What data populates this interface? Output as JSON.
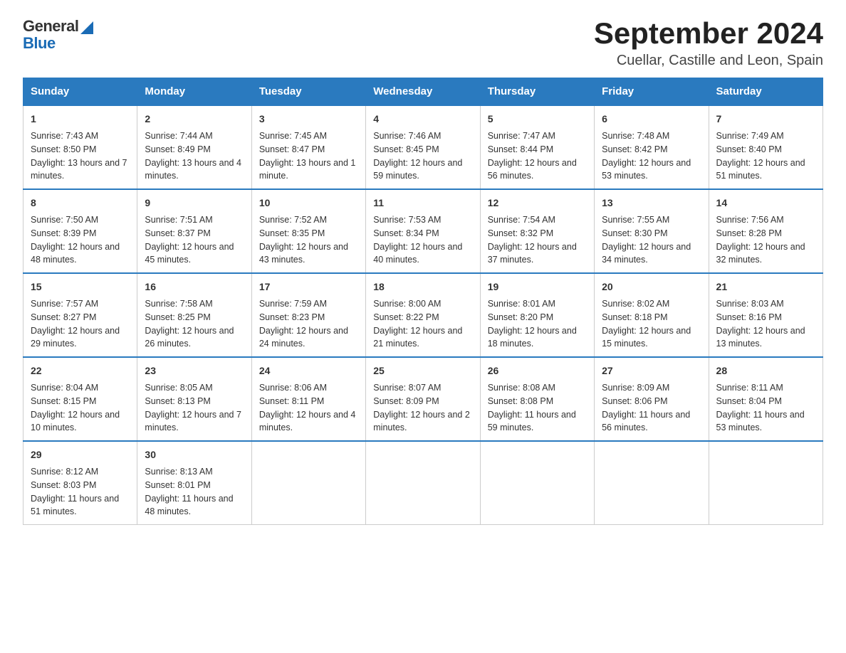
{
  "header": {
    "logo_general": "General",
    "logo_blue": "Blue",
    "month_year": "September 2024",
    "location": "Cuellar, Castille and Leon, Spain"
  },
  "days_of_week": [
    "Sunday",
    "Monday",
    "Tuesday",
    "Wednesday",
    "Thursday",
    "Friday",
    "Saturday"
  ],
  "weeks": [
    [
      {
        "day": "1",
        "sunrise": "Sunrise: 7:43 AM",
        "sunset": "Sunset: 8:50 PM",
        "daylight": "Daylight: 13 hours and 7 minutes."
      },
      {
        "day": "2",
        "sunrise": "Sunrise: 7:44 AM",
        "sunset": "Sunset: 8:49 PM",
        "daylight": "Daylight: 13 hours and 4 minutes."
      },
      {
        "day": "3",
        "sunrise": "Sunrise: 7:45 AM",
        "sunset": "Sunset: 8:47 PM",
        "daylight": "Daylight: 13 hours and 1 minute."
      },
      {
        "day": "4",
        "sunrise": "Sunrise: 7:46 AM",
        "sunset": "Sunset: 8:45 PM",
        "daylight": "Daylight: 12 hours and 59 minutes."
      },
      {
        "day": "5",
        "sunrise": "Sunrise: 7:47 AM",
        "sunset": "Sunset: 8:44 PM",
        "daylight": "Daylight: 12 hours and 56 minutes."
      },
      {
        "day": "6",
        "sunrise": "Sunrise: 7:48 AM",
        "sunset": "Sunset: 8:42 PM",
        "daylight": "Daylight: 12 hours and 53 minutes."
      },
      {
        "day": "7",
        "sunrise": "Sunrise: 7:49 AM",
        "sunset": "Sunset: 8:40 PM",
        "daylight": "Daylight: 12 hours and 51 minutes."
      }
    ],
    [
      {
        "day": "8",
        "sunrise": "Sunrise: 7:50 AM",
        "sunset": "Sunset: 8:39 PM",
        "daylight": "Daylight: 12 hours and 48 minutes."
      },
      {
        "day": "9",
        "sunrise": "Sunrise: 7:51 AM",
        "sunset": "Sunset: 8:37 PM",
        "daylight": "Daylight: 12 hours and 45 minutes."
      },
      {
        "day": "10",
        "sunrise": "Sunrise: 7:52 AM",
        "sunset": "Sunset: 8:35 PM",
        "daylight": "Daylight: 12 hours and 43 minutes."
      },
      {
        "day": "11",
        "sunrise": "Sunrise: 7:53 AM",
        "sunset": "Sunset: 8:34 PM",
        "daylight": "Daylight: 12 hours and 40 minutes."
      },
      {
        "day": "12",
        "sunrise": "Sunrise: 7:54 AM",
        "sunset": "Sunset: 8:32 PM",
        "daylight": "Daylight: 12 hours and 37 minutes."
      },
      {
        "day": "13",
        "sunrise": "Sunrise: 7:55 AM",
        "sunset": "Sunset: 8:30 PM",
        "daylight": "Daylight: 12 hours and 34 minutes."
      },
      {
        "day": "14",
        "sunrise": "Sunrise: 7:56 AM",
        "sunset": "Sunset: 8:28 PM",
        "daylight": "Daylight: 12 hours and 32 minutes."
      }
    ],
    [
      {
        "day": "15",
        "sunrise": "Sunrise: 7:57 AM",
        "sunset": "Sunset: 8:27 PM",
        "daylight": "Daylight: 12 hours and 29 minutes."
      },
      {
        "day": "16",
        "sunrise": "Sunrise: 7:58 AM",
        "sunset": "Sunset: 8:25 PM",
        "daylight": "Daylight: 12 hours and 26 minutes."
      },
      {
        "day": "17",
        "sunrise": "Sunrise: 7:59 AM",
        "sunset": "Sunset: 8:23 PM",
        "daylight": "Daylight: 12 hours and 24 minutes."
      },
      {
        "day": "18",
        "sunrise": "Sunrise: 8:00 AM",
        "sunset": "Sunset: 8:22 PM",
        "daylight": "Daylight: 12 hours and 21 minutes."
      },
      {
        "day": "19",
        "sunrise": "Sunrise: 8:01 AM",
        "sunset": "Sunset: 8:20 PM",
        "daylight": "Daylight: 12 hours and 18 minutes."
      },
      {
        "day": "20",
        "sunrise": "Sunrise: 8:02 AM",
        "sunset": "Sunset: 8:18 PM",
        "daylight": "Daylight: 12 hours and 15 minutes."
      },
      {
        "day": "21",
        "sunrise": "Sunrise: 8:03 AM",
        "sunset": "Sunset: 8:16 PM",
        "daylight": "Daylight: 12 hours and 13 minutes."
      }
    ],
    [
      {
        "day": "22",
        "sunrise": "Sunrise: 8:04 AM",
        "sunset": "Sunset: 8:15 PM",
        "daylight": "Daylight: 12 hours and 10 minutes."
      },
      {
        "day": "23",
        "sunrise": "Sunrise: 8:05 AM",
        "sunset": "Sunset: 8:13 PM",
        "daylight": "Daylight: 12 hours and 7 minutes."
      },
      {
        "day": "24",
        "sunrise": "Sunrise: 8:06 AM",
        "sunset": "Sunset: 8:11 PM",
        "daylight": "Daylight: 12 hours and 4 minutes."
      },
      {
        "day": "25",
        "sunrise": "Sunrise: 8:07 AM",
        "sunset": "Sunset: 8:09 PM",
        "daylight": "Daylight: 12 hours and 2 minutes."
      },
      {
        "day": "26",
        "sunrise": "Sunrise: 8:08 AM",
        "sunset": "Sunset: 8:08 PM",
        "daylight": "Daylight: 11 hours and 59 minutes."
      },
      {
        "day": "27",
        "sunrise": "Sunrise: 8:09 AM",
        "sunset": "Sunset: 8:06 PM",
        "daylight": "Daylight: 11 hours and 56 minutes."
      },
      {
        "day": "28",
        "sunrise": "Sunrise: 8:11 AM",
        "sunset": "Sunset: 8:04 PM",
        "daylight": "Daylight: 11 hours and 53 minutes."
      }
    ],
    [
      {
        "day": "29",
        "sunrise": "Sunrise: 8:12 AM",
        "sunset": "Sunset: 8:03 PM",
        "daylight": "Daylight: 11 hours and 51 minutes."
      },
      {
        "day": "30",
        "sunrise": "Sunrise: 8:13 AM",
        "sunset": "Sunset: 8:01 PM",
        "daylight": "Daylight: 11 hours and 48 minutes."
      },
      null,
      null,
      null,
      null,
      null
    ]
  ]
}
